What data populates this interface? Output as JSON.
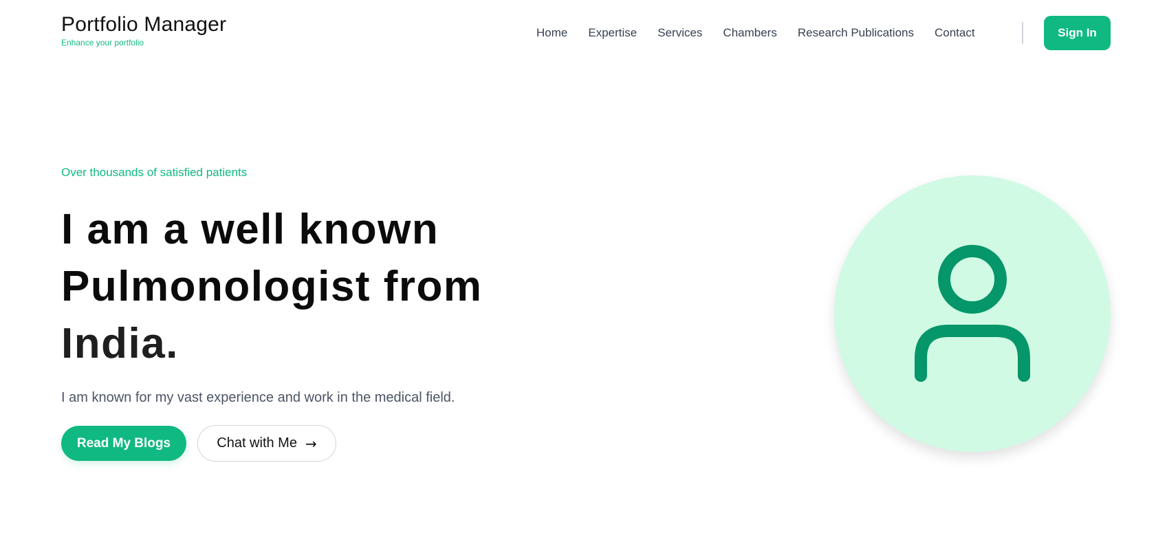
{
  "header": {
    "brand_title": "Portfolio Manager",
    "brand_tagline": "Enhance your portfolio",
    "nav": [
      "Home",
      "Expertise",
      "Services",
      "Chambers",
      "Research Publications",
      "Contact"
    ],
    "signin_label": "Sign In"
  },
  "hero": {
    "eyebrow": "Over thousands of satisfied patients",
    "headline_line1": "I am a well known",
    "headline_line2": "Pulmonologist from",
    "headline_line3": "India.",
    "subtext": "I am known for my vast experience and work in the medical field.",
    "primary_cta": "Read My Blogs",
    "secondary_cta": "Chat with Me",
    "secondary_cta_icon": "arrow-right-icon"
  },
  "avatar": {
    "icon": "user-icon"
  },
  "colors": {
    "accent": "#10b981",
    "avatar_bg": "#d1fae5",
    "avatar_icon": "#059669"
  }
}
